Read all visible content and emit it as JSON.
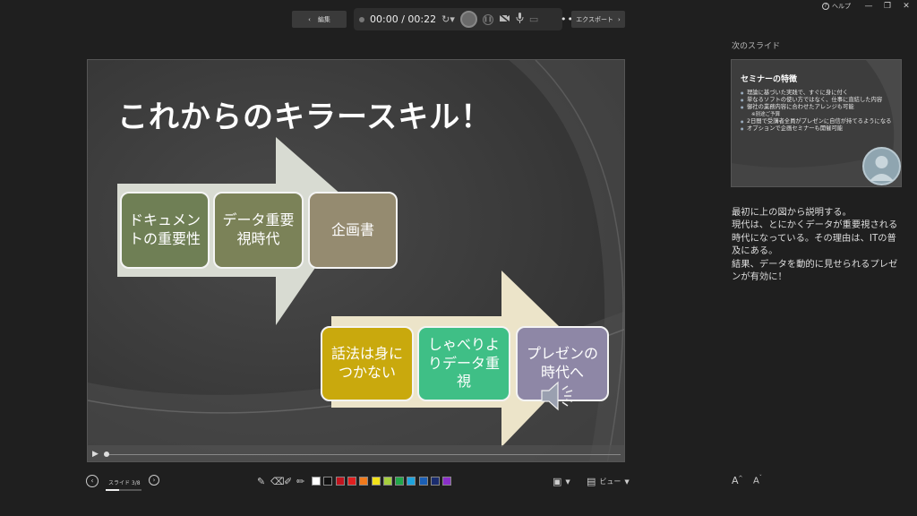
{
  "window": {
    "help_label": "ヘルプ"
  },
  "toolbar": {
    "edit_label": "編集",
    "time": "00:00 / 00:22",
    "export_label": "エクスポート"
  },
  "slide": {
    "title": "これからのキラースキル！",
    "boxes": [
      "ドキュメントの重要性",
      "データ重要視時代",
      "企画書",
      "話法は身につかない",
      "しゃべりよりデータ重視",
      "プレゼンの時代へ"
    ]
  },
  "right_panel": {
    "next_label": "次のスライド",
    "next_title": "セミナーの特徴",
    "next_items": [
      "理論に基づいた実践で、すぐに身に付く",
      "単なるソフトの使い方ではなく、仕事に直結した内容",
      "御社の業務内容に合わせたアレンジも可能",
      "※別途ご予算",
      "2日間で受講者全員がプレゼンに自信が持てるようになる",
      "オプションで企画セミナーも開催可能"
    ],
    "notes": "最初に上の図から説明する。\n現代は、とにかくデータが重要視される時代になっている。その理由は、ITの普及にある。\n結果、データを動的に見せられるプレゼンが有効に！",
    "font_up": "A",
    "font_down": "A"
  },
  "bottom": {
    "slide_counter": "スライド 3/8",
    "view_label": "ビュー"
  },
  "colors": {
    "swatches": [
      "#ffffff",
      "#111111",
      "#c0141e",
      "#e02020",
      "#f07a1c",
      "#f2e21a",
      "#a6cf3e",
      "#22a64a",
      "#1fa3dc",
      "#1b5fb5",
      "#1a2c6e",
      "#8a2fc9"
    ],
    "box_fill_1": "#6f7f55",
    "box_fill_4": "#c9a90d",
    "box_fill_5": "#3fbf86",
    "box_fill_6": "#8e87a6"
  }
}
